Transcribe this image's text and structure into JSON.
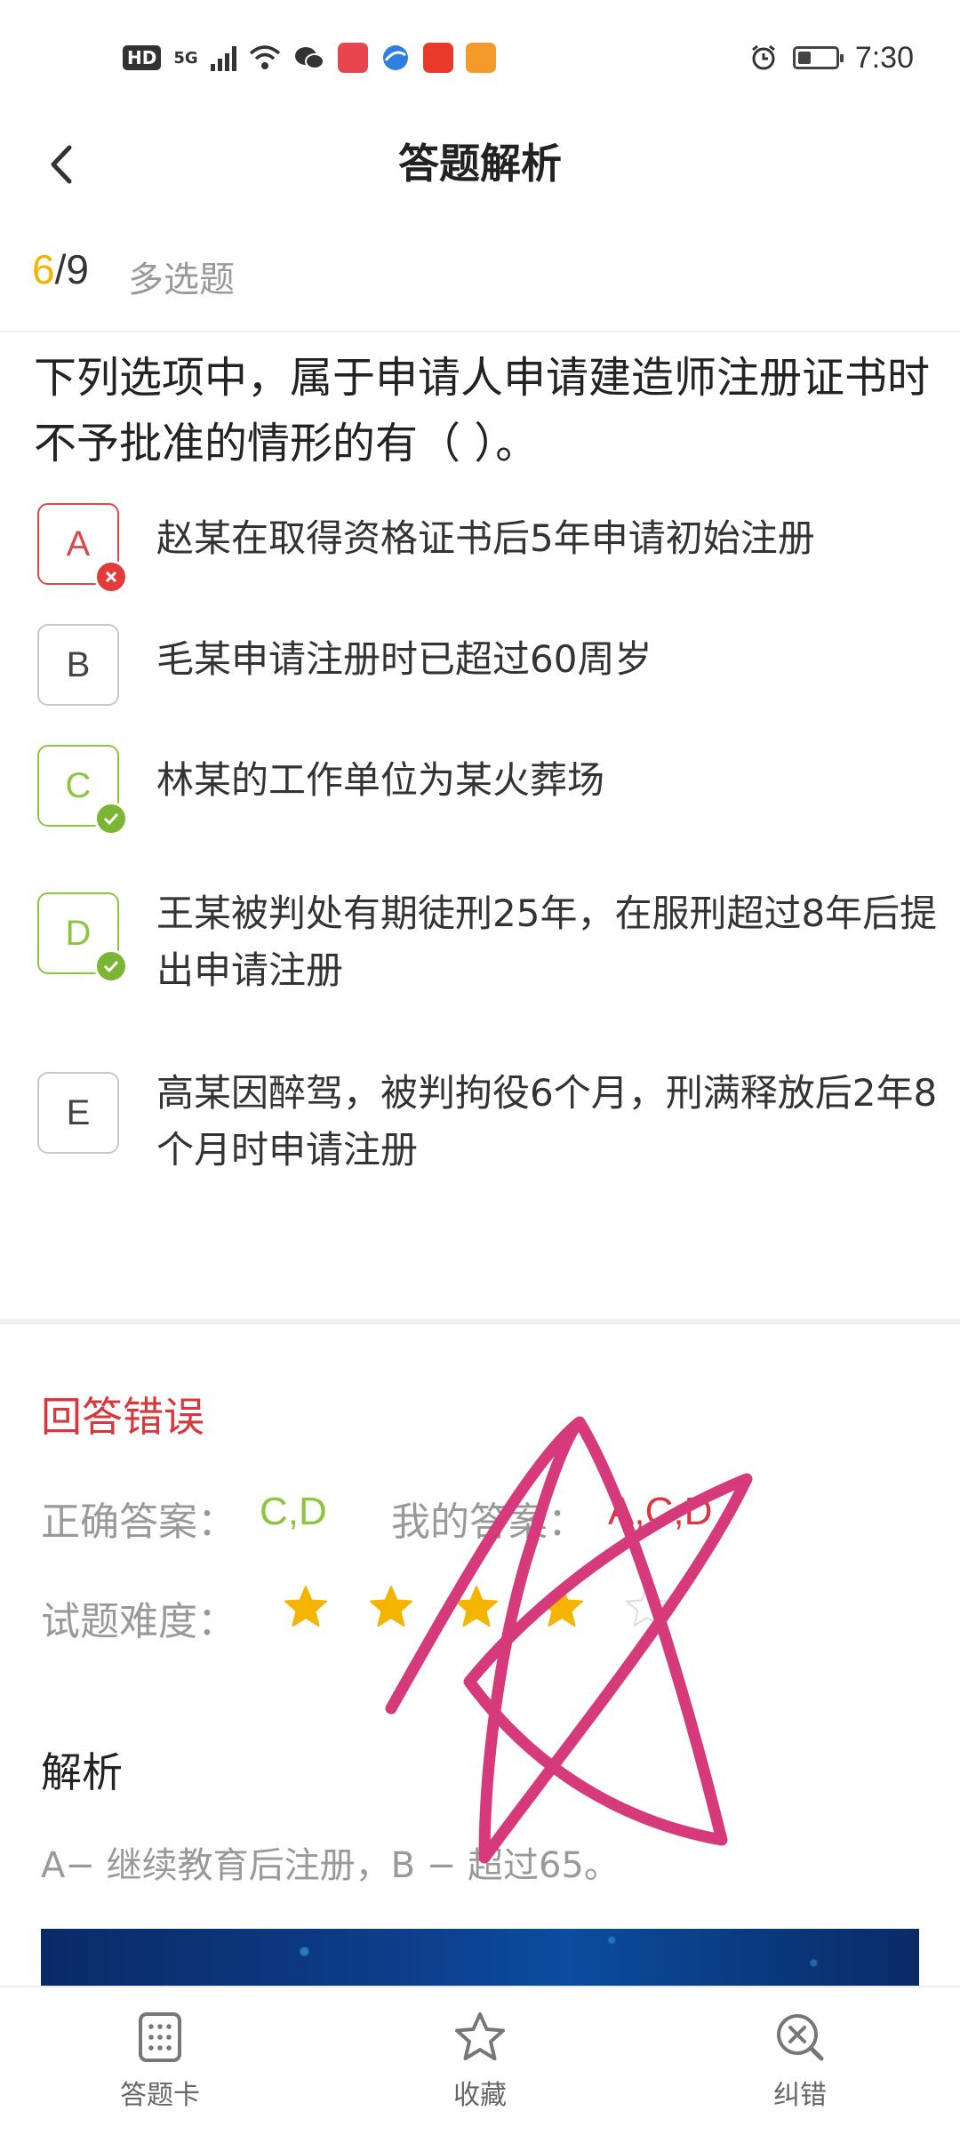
{
  "status_bar": {
    "hd": "HD",
    "network": "5G",
    "time": "7:30",
    "battery_level": 0.35,
    "icons": [
      "signal-icon",
      "wifi-icon",
      "wechat-icon",
      "reader-app-icon",
      "browser-app-icon",
      "taobao-app-icon",
      "video-app-icon",
      "alarm-icon",
      "battery-icon"
    ]
  },
  "header": {
    "title": "答题解析",
    "back_icon": "chevron-left-icon"
  },
  "progress": {
    "current": "6",
    "separator": "/",
    "total": "9",
    "question_type": "多选题"
  },
  "question": {
    "text": "下列选项中，属于申请人申请建造师注册证书时不予批准的情形的有（  ）。"
  },
  "options": [
    {
      "letter": "A",
      "text": "赵某在取得资格证书后5年申请初始注册",
      "state": "wrong"
    },
    {
      "letter": "B",
      "text": "毛某申请注册时已超过60周岁",
      "state": "normal"
    },
    {
      "letter": "C",
      "text": "林某的工作单位为某火葬场",
      "state": "correct"
    },
    {
      "letter": "D",
      "text": "王某被判处有期徒刑25年，在服刑超过8年后提出申请注册",
      "state": "correct"
    },
    {
      "letter": "E",
      "text": "高某因醉驾，被判拘役6个月，刑满释放后2年8个月时申请注册",
      "state": "normal"
    }
  ],
  "result": {
    "status": "回答错误",
    "correct_label": "正确答案：",
    "correct_answer": "C,D",
    "my_label": "我的答案：",
    "my_answer": "A,C,D",
    "difficulty_label": "试题难度：",
    "difficulty_stars": 4,
    "difficulty_max": 5
  },
  "analysis": {
    "title": "解析",
    "text": "A− 继续教育后注册，B − 超过65。"
  },
  "tabbar": {
    "items": [
      {
        "label": "答题卡",
        "icon": "answer-card-icon"
      },
      {
        "label": "收藏",
        "icon": "star-outline-icon"
      },
      {
        "label": "纠错",
        "icon": "error-report-icon"
      }
    ]
  },
  "colors": {
    "accent_yellow": "#f5b400",
    "wrong_red": "#d9363e",
    "correct_green": "#8cc63f",
    "scribble_pink": "#d63a7a"
  }
}
